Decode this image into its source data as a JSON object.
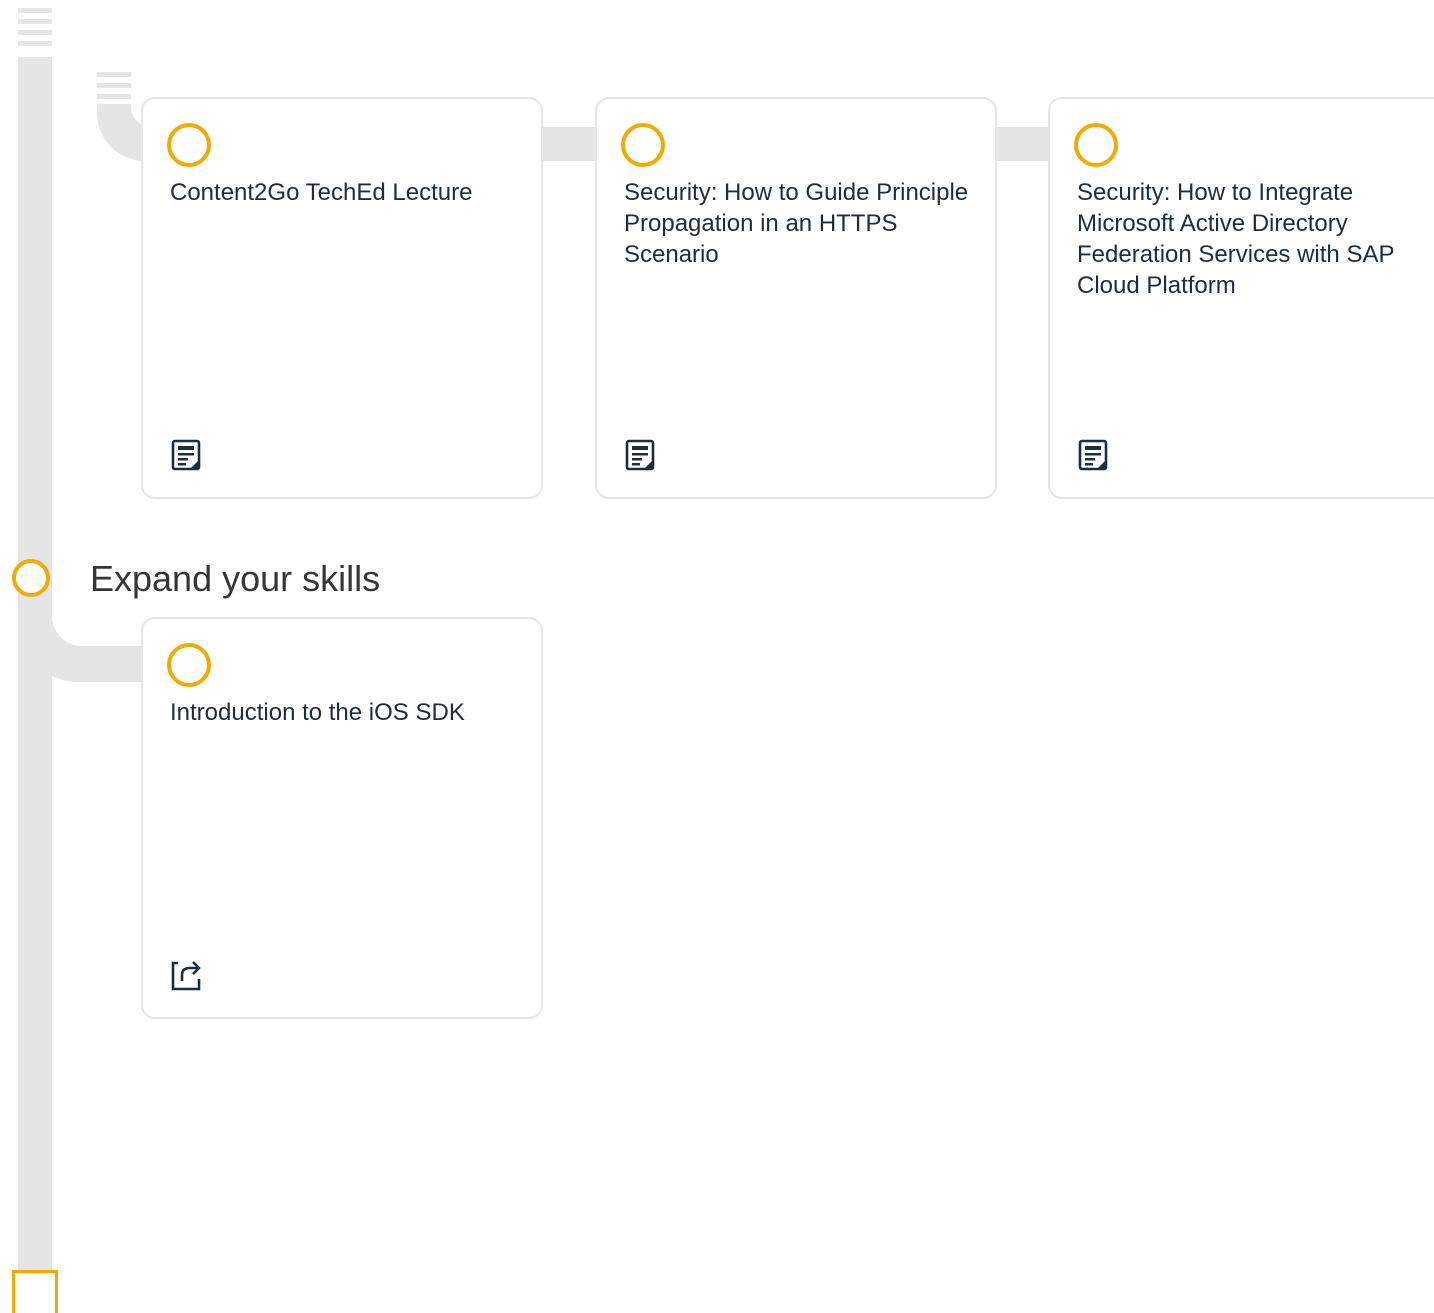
{
  "cards": [
    {
      "title": "Content2Go TechEd Lecture",
      "icon": "document-icon"
    },
    {
      "title": "Security: How to Guide Principle Propagation in an HTTPS Scenario",
      "icon": "document-icon"
    },
    {
      "title": "Security: How to Integrate Microsoft Active Directory Federation Services with SAP Cloud Platform",
      "icon": "document-icon"
    }
  ],
  "section": {
    "title": "Expand your skills",
    "cards": [
      {
        "title": "Introduction to the iOS SDK",
        "icon": "external-link-icon"
      }
    ]
  },
  "colors": {
    "accent": "#f0ab00",
    "rail": "#e5e5e5",
    "border": "#e6e6e6"
  }
}
